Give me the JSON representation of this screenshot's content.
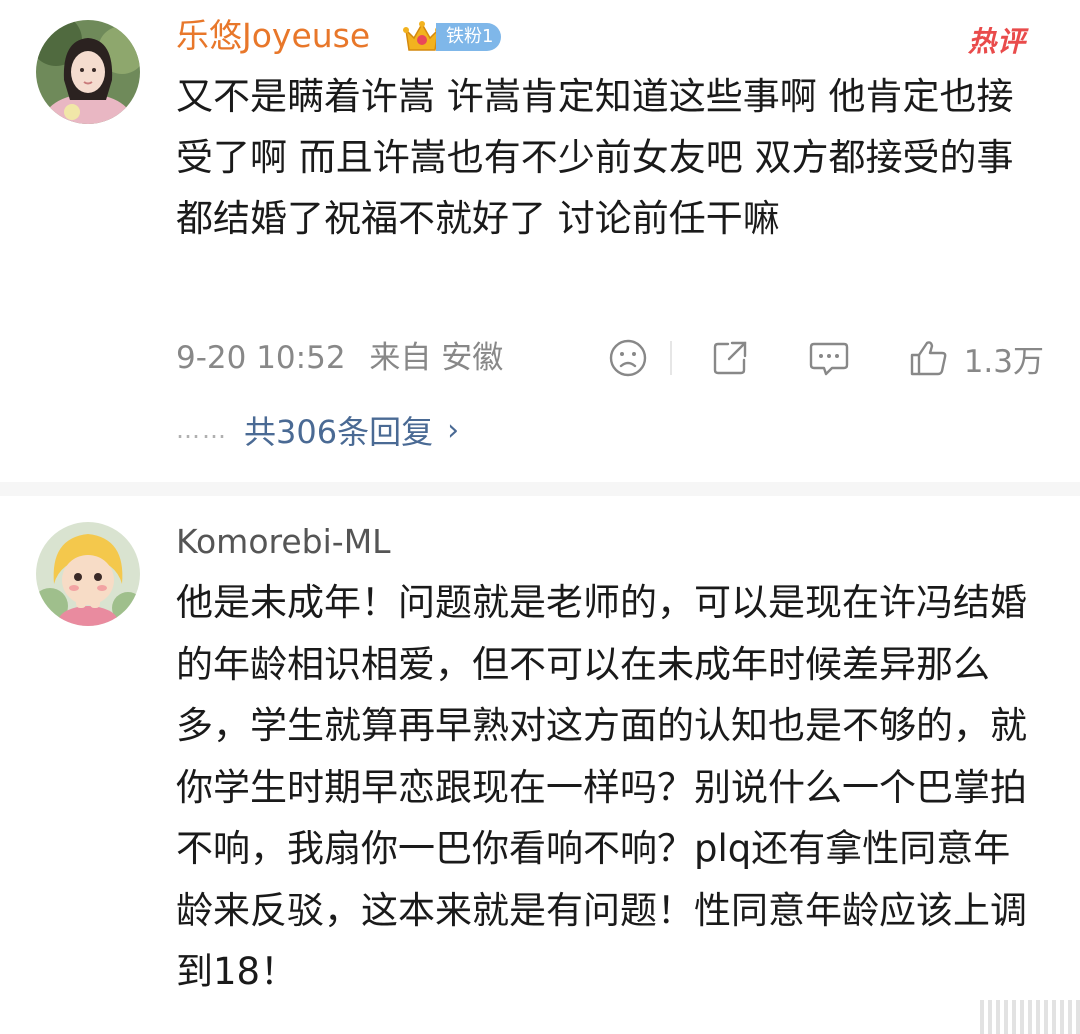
{
  "comments": [
    {
      "username": "乐悠Joyeuse",
      "badge": "铁粉1",
      "hot_tag": "热评",
      "text": "又不是瞒着许嵩 许嵩肯定知道这些事啊 他肯定也接受了啊 而且许嵩也有不少前女友吧 双方都接受的事 都结婚了祝福不就好了 讨论前任干嘛",
      "timestamp": "9-20 10:52",
      "location": "来自 安徽",
      "likes": "1.3万",
      "replies_label": "共306条回复",
      "replies_dots": "……",
      "reply_chevron": "›"
    },
    {
      "username": "Komorebi-ML",
      "text": "他是未成年！问题就是老师的，可以是现在许冯结婚的年龄相识相爱，但不可以在未成年时候差异那么多，学生就算再早熟对这方面的认知也是不够的，就你学生时期早恋跟现在一样吗？别说什么一个巴掌拍不响，我扇你一巴你看响不响？plq还有拿性同意年龄来反驳，这本来就是有问题！性同意年龄应该上调到18！"
    }
  ],
  "icons": {
    "crown": "crown-icon",
    "emoji": "sad-face-icon",
    "share": "share-icon",
    "comment": "comment-icon",
    "like": "thumbs-up-icon"
  },
  "colors": {
    "highlight_username": "#e8772a",
    "badge_bg": "#7fb7e9",
    "hot_tag": "#e94b4b",
    "reply_link": "#4a6a94",
    "meta_gray": "#888888"
  }
}
